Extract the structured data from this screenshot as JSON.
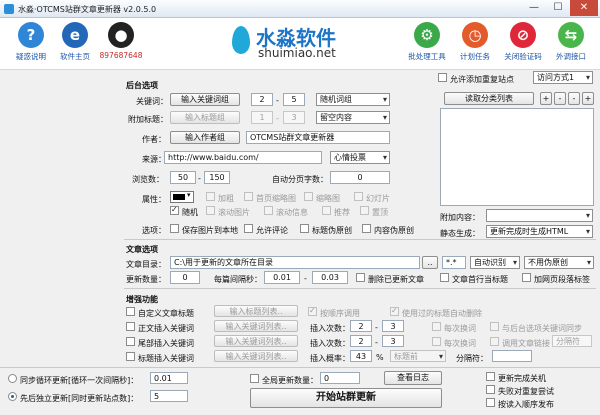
{
  "window": {
    "title": "水淼·OTCMS站群文章更新器 v2.0.5.0",
    "min": "—",
    "max": "☐",
    "close": "✕"
  },
  "toolbar": {
    "left": [
      {
        "label": "疑惑说明",
        "color": "#2f86d6",
        "glyph": "?"
      },
      {
        "label": "软件主页",
        "color": "#2367b8",
        "glyph": "e"
      },
      {
        "label": "897687648",
        "color": "#222222",
        "glyph": "●"
      }
    ],
    "logo": {
      "cn": "水淼软件",
      "en": "shuimiao.net"
    },
    "right": [
      {
        "label": "批处理工具",
        "color": "#3ba84a",
        "glyph": "⚙"
      },
      {
        "label": "计划任务",
        "color": "#e35b2b",
        "glyph": "◷"
      },
      {
        "label": "关闭验证码",
        "color": "#e0273a",
        "glyph": "⊘"
      },
      {
        "label": "外调接口",
        "color": "#49b54a",
        "glyph": "⇆"
      }
    ]
  },
  "backend": {
    "title": "后台选项",
    "keyword_label": "关键词：",
    "keyword_btn": "输入关键词组",
    "kw_min": "2",
    "kw_dash": "-",
    "kw_max": "5",
    "kw_mode": "随机词组",
    "subtitle_label": "附加标题：",
    "subtitle_btn": "输入标题组",
    "st_min": "1",
    "st_dash": "-",
    "st_max": "3",
    "st_mode": "留空内容",
    "author_label": "作者：",
    "author_btn": "输入作者组",
    "author_value": "OTCMS站群文章更新器",
    "source_label": "来源：",
    "source_value": "http://www.baidu.com/",
    "source_mode": "心情投票",
    "views_label": "浏览数：",
    "views_min": "50",
    "views_dash": "-",
    "views_max": "150",
    "autopage_label": "自动分页字数：",
    "autopage_value": "0",
    "attr_label": "属性：",
    "attr_color": "#000000",
    "attrs": [
      {
        "label": "加粗",
        "on": false,
        "dis": true
      },
      {
        "label": "首页缩略图",
        "on": false,
        "dis": true
      },
      {
        "label": "缩略图",
        "on": false,
        "dis": true
      },
      {
        "label": "幻灯片",
        "on": false,
        "dis": true
      },
      {
        "label": "随机",
        "on": true,
        "dis": false
      },
      {
        "label": "滚动图片",
        "on": false,
        "dis": true
      },
      {
        "label": "滚动信息",
        "on": false,
        "dis": true
      },
      {
        "label": "推荐",
        "on": false,
        "dis": true
      },
      {
        "label": "置顶",
        "on": false,
        "dis": true
      }
    ],
    "options_label": "选项：",
    "options": [
      {
        "label": "保存图片到本地",
        "on": false
      },
      {
        "label": "允许评论",
        "on": false
      },
      {
        "label": "标题伪原创",
        "on": false
      },
      {
        "label": "内容伪原创",
        "on": false
      }
    ]
  },
  "right_panel": {
    "allow_add_site": "允许添加重复站点",
    "access_mode": "访问方式1",
    "read_btn": "读取分类列表",
    "plus": "+",
    "minus": "-",
    "minus2": "-",
    "plus2": "+",
    "extra_label": "附加内容：",
    "extra_value": "",
    "static_label": "静态生成：",
    "static_value": "更新完成时生成HTML"
  },
  "article": {
    "title": "文章选项",
    "dir_label": "文章目录：",
    "dir_value": "C:\\用于更新的文章所在目录",
    "dir_btn": "..",
    "ext_value": "*.*",
    "encoding": "自动识别",
    "order": "不用伪原创",
    "count_label": "更新数量：",
    "count_value": "0",
    "interval_label": "每篇间隔秒：",
    "iv_min": "0.01",
    "iv_dash": "-",
    "iv_max": "0.03",
    "delete_after": "删除已更新文章",
    "first_line_title": "文章首行当标题",
    "append_tail": "加网页段落标签"
  },
  "enhance": {
    "title": "增强功能",
    "rows": [
      {
        "label": "自定义文章标题",
        "btn": "输入标题列表..",
        "right": "按顺序调用"
      },
      {
        "label": "正文插入关键词",
        "btn": "输入关键词列表..",
        "ins_label": "插入次数：",
        "a": "2",
        "b": "3",
        "right": "每次换词"
      },
      {
        "label": "尾部插入关键词",
        "btn": "输入关键词列表..",
        "ins_label": "插入次数：",
        "a": "2",
        "b": "3",
        "right": "每次换词"
      },
      {
        "label": "标题插入关键词",
        "btn": "输入关键词列表..",
        "ins_label": "插入概率：",
        "a": "43",
        "b": "%",
        "right": "标题前"
      }
    ],
    "dash": "-",
    "use_old": "使用过的标题自动删除",
    "sync_kw": "与后台选项关键词同步",
    "link_kw": "调用文章链接",
    "link_placeholder": "分隔符",
    "sep_label": "分隔符："
  },
  "footer": {
    "loop_label": "同步循环更新[循环一次间隔秒]：",
    "loop_value": "0.01",
    "site_label": "先后独立更新[同时更新站点数]：",
    "site_value": "5",
    "global_label": "全局更新数量：",
    "global_value": "0",
    "log_btn": "查看日志",
    "start_btn": "开始站群更新",
    "opt1": "更新完成关机",
    "opt2": "失败对重复尝试",
    "opt3": "按读入顺序发布"
  }
}
